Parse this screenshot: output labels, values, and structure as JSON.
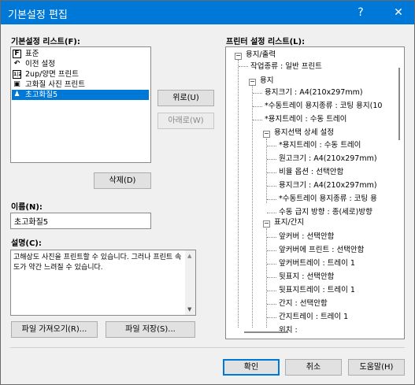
{
  "window": {
    "title": "기본설정 편집",
    "help_btn": "?",
    "close_btn": "✕"
  },
  "left": {
    "list_label": "기본설정 리스트(F):",
    "items": [
      {
        "icon": "F",
        "label": "표준"
      },
      {
        "icon": "↶",
        "label": "이전 설정"
      },
      {
        "icon": "1|2",
        "label": "2up/양면 프린트"
      },
      {
        "icon": "▣",
        "label": "고화질 사진 프린트"
      },
      {
        "icon": "♟",
        "label": "초고화질5"
      }
    ],
    "delete_btn": "삭제(D)",
    "name_label": "이름(N):",
    "name_value": "초고화질5",
    "desc_label": "설명(C):",
    "desc_text": "고해상도 사진을 프린트할 수 있습니다. 그러나 프린트 속도가 약간 느려질 수 있습니다.",
    "import_btn": "파일 가져오기(R)...",
    "save_btn": "파일 저장(S)..."
  },
  "middle": {
    "up_btn": "위로(U)",
    "down_btn": "아래로(W)"
  },
  "right": {
    "list_label": "프린터 설정 리스트(L):",
    "tree": [
      {
        "text": "용지/출력",
        "tog": "−"
      },
      {
        "text": "작업종류 : 일반 프린트"
      },
      {
        "text": "용지",
        "tog": "−"
      },
      {
        "text": "용지크기 : A4(210x297mm)"
      },
      {
        "text": "*수동트레이 용지종류 : 코팅 용지(10"
      },
      {
        "text": "*용지트레이 : 수동 트레이"
      },
      {
        "text": "용지선택 상세 설정",
        "tog": "−"
      },
      {
        "text": "*용지트레이 : 수동 트레이"
      },
      {
        "text": "원고크기 : A4(210x297mm)"
      },
      {
        "text": "비율 옵션 : 선택안함"
      },
      {
        "text": "용지크기 : A4(210x297mm)"
      },
      {
        "text": "*수동트레이 용지종류 : 코팅 용"
      },
      {
        "text": "수동 급지 방향 : 종(세로)방향"
      },
      {
        "text": "표지/간지",
        "tog": "−"
      },
      {
        "text": "앞커버 : 선택안함"
      },
      {
        "text": "앞커버에 프린트 : 선택안함"
      },
      {
        "text": "앞커버트레이 : 트레이 1"
      },
      {
        "text": "뒷표지 : 선택안함"
      },
      {
        "text": "뒷표지트레이 : 트레이 1"
      },
      {
        "text": "간지 : 선택안함"
      },
      {
        "text": "간지트레이 : 트레이 1"
      },
      {
        "text": "위치 :"
      }
    ]
  },
  "footer": {
    "ok_btn": "확인",
    "cancel_btn": "취소",
    "help_btn": "도움말(H)"
  }
}
